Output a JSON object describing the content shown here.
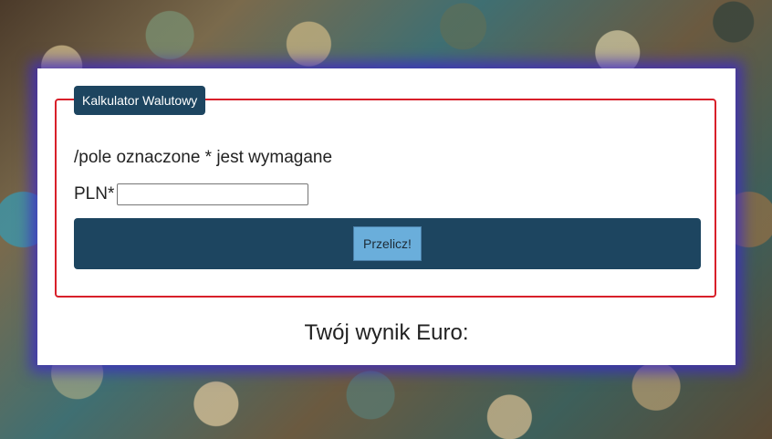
{
  "form": {
    "legend": "Kalkulator Walutowy",
    "required_note": "/pole oznaczone * jest wymagane",
    "pln_label": "PLN*",
    "pln_value": "",
    "submit_label": "Przelicz!"
  },
  "result": {
    "label": "Twój wynik Euro:"
  },
  "colors": {
    "panel_background": "#ffffff",
    "border_accent": "#d8202a",
    "bar_navy": "#1d4560",
    "button_blue": "#6aaedb"
  }
}
